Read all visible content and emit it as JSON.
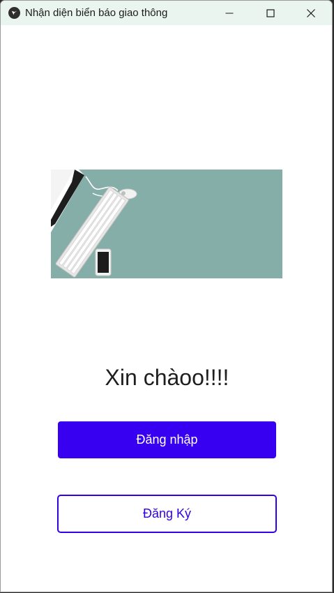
{
  "window": {
    "title": "Nhận diện biển báo giao thông",
    "app_icon": "kivy-logo-icon",
    "controls": [
      "minimize-icon",
      "maximize-icon",
      "close-icon"
    ]
  },
  "hero": {
    "image": "desk-with-monitor-keyboard-mouse-phone",
    "background_color": "#86aea8"
  },
  "main": {
    "greeting": "Xin chàoo!!!!",
    "login_label": "Đăng nhập",
    "register_label": "Đăng Ký"
  },
  "colors": {
    "accent": "#3700f0",
    "titlebar": "#eaf5ef"
  }
}
